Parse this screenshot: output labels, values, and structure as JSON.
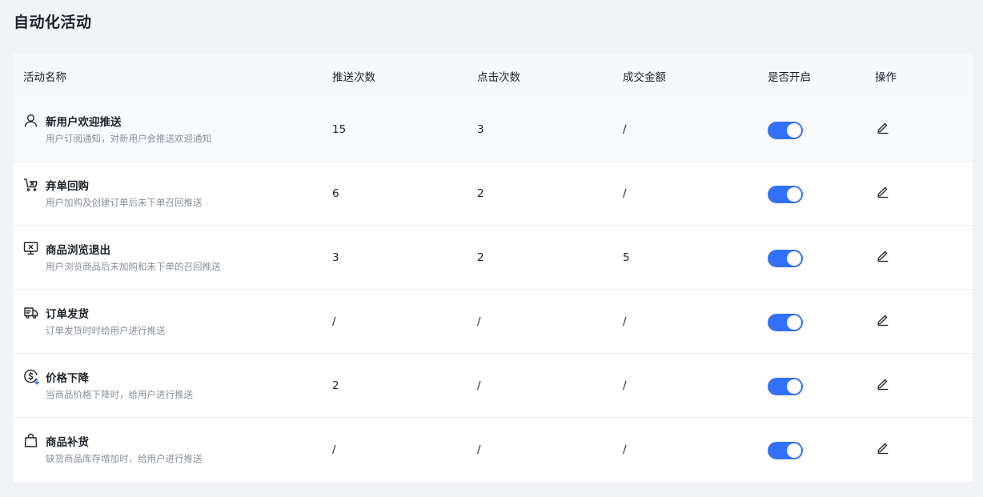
{
  "page": {
    "title": "自动化活动"
  },
  "table": {
    "columns": [
      "活动名称",
      "推送次数",
      "点击次数",
      "成交金额",
      "是否开启",
      "操作"
    ],
    "rows": [
      {
        "icon": "user-icon",
        "name": "新用户欢迎推送",
        "desc": "用户订阅通知，对新用户会推送欢迎通知",
        "push": "15",
        "click": "3",
        "amount": "/",
        "enabled": true
      },
      {
        "icon": "cart-icon",
        "name": "弃单回购",
        "desc": "用户加购及创建订单后未下单召回推送",
        "push": "6",
        "click": "2",
        "amount": "/",
        "enabled": true
      },
      {
        "icon": "monitor-icon",
        "name": "商品浏览退出",
        "desc": "用户浏览商品后未加购和未下单的召回推送",
        "push": "3",
        "click": "2",
        "amount": "5",
        "enabled": true
      },
      {
        "icon": "truck-icon",
        "name": "订单发货",
        "desc": "订单发货时时给用户进行推送",
        "push": "/",
        "click": "/",
        "amount": "/",
        "enabled": true
      },
      {
        "icon": "price-drop-icon",
        "name": "价格下降",
        "desc": "当商品价格下降时，给用户进行推送",
        "push": "2",
        "click": "/",
        "amount": "/",
        "enabled": true
      },
      {
        "icon": "shopping-bag-icon",
        "name": "商品补货",
        "desc": "缺货商品库存增加时，给用户进行推送",
        "push": "/",
        "click": "/",
        "amount": "/",
        "enabled": true
      }
    ]
  },
  "colors": {
    "accent": "#3370ff",
    "background": "#f2f3f6",
    "header": "#f6f8fb"
  }
}
